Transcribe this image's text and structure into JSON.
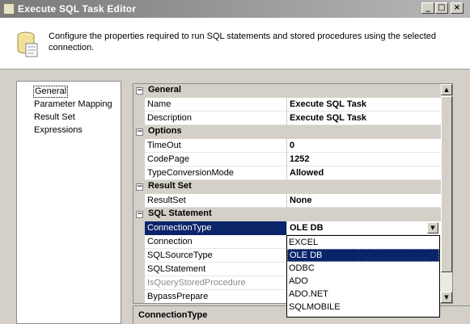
{
  "window": {
    "title": "Execute SQL Task Editor",
    "buttons": {
      "minimize": "_",
      "maximize": "□",
      "close": "×"
    }
  },
  "header": {
    "description": "Configure the properties required to run SQL statements and stored procedures using the selected connection.",
    "icon": "database-icon"
  },
  "nav": {
    "items": [
      {
        "label": "General",
        "selected": true
      },
      {
        "label": "Parameter Mapping",
        "selected": false
      },
      {
        "label": "Result Set",
        "selected": false
      },
      {
        "label": "Expressions",
        "selected": false
      }
    ]
  },
  "grid": {
    "categories": {
      "general": "General",
      "options": "Options",
      "result_set": "Result Set",
      "sql_statement": "SQL Statement"
    },
    "expander_glyph": "⊟",
    "properties": {
      "name": {
        "label": "Name",
        "value": "Execute SQL Task"
      },
      "description": {
        "label": "Description",
        "value": "Execute SQL Task"
      },
      "timeout": {
        "label": "TimeOut",
        "value": "0"
      },
      "codepage": {
        "label": "CodePage",
        "value": "1252"
      },
      "typeconversionmode": {
        "label": "TypeConversionMode",
        "value": "Allowed"
      },
      "resultset": {
        "label": "ResultSet",
        "value": "None"
      },
      "connectiontype": {
        "label": "ConnectionType",
        "value": "OLE DB"
      },
      "connection": {
        "label": "Connection",
        "value": ""
      },
      "sqlsourcetype": {
        "label": "SQLSourceType",
        "value": ""
      },
      "sqlstatement": {
        "label": "SQLStatement",
        "value": ""
      },
      "isquerystoredprocedure": {
        "label": "IsQueryStoredProcedure",
        "value": ""
      },
      "bypassprepare": {
        "label": "BypassPrepare",
        "value": ""
      }
    },
    "combo_arrow": "▼"
  },
  "dropdown": {
    "options": [
      "EXCEL",
      "OLE DB",
      "ODBC",
      "ADO",
      "ADO.NET",
      "SQLMOBILE"
    ],
    "selected": "OLE DB"
  },
  "scrollbar": {
    "up": "▲",
    "down": "▼"
  },
  "help": {
    "title": "ConnectionType"
  },
  "colors": {
    "selection": "#0a246a",
    "chrome": "#d4d0c8",
    "titlebar": "#7a7a7a"
  }
}
